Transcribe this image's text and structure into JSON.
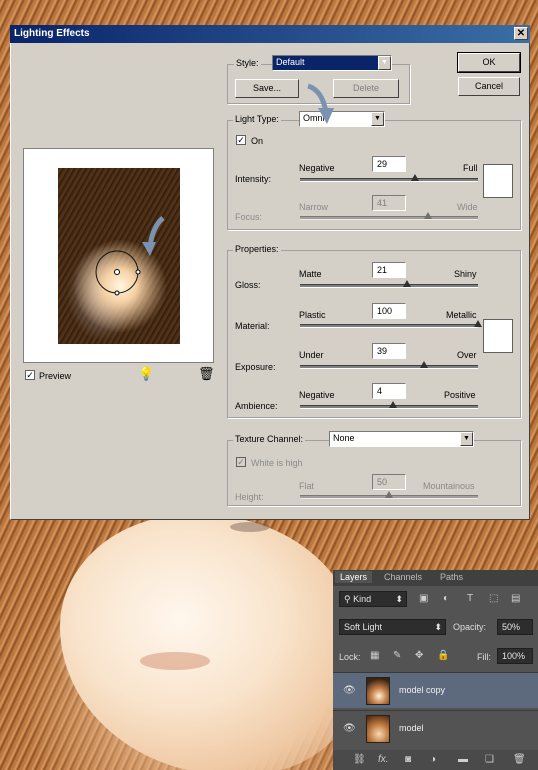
{
  "dialog": {
    "title": "Lighting Effects",
    "close": "✕",
    "ok": "OK",
    "cancel": "Cancel",
    "style_label": "Style:",
    "style_value": "Default",
    "save": "Save...",
    "delete": "Delete",
    "light_type_label": "Light Type:",
    "light_type_value": "Omni",
    "on_label": "On",
    "on_checked": "✓",
    "intensity": {
      "label": "Intensity:",
      "left": "Negative",
      "right": "Full",
      "value": "29"
    },
    "focus": {
      "label": "Focus:",
      "left": "Narrow",
      "right": "Wide",
      "value": "41"
    },
    "properties_label": "Properties:",
    "gloss": {
      "label": "Gloss:",
      "left": "Matte",
      "right": "Shiny",
      "value": "21"
    },
    "material": {
      "label": "Material:",
      "left": "Plastic",
      "right": "Metallic",
      "value": "100"
    },
    "exposure": {
      "label": "Exposure:",
      "left": "Under",
      "right": "Over",
      "value": "39"
    },
    "ambience": {
      "label": "Ambience:",
      "left": "Negative",
      "right": "Positive",
      "value": "4"
    },
    "texture_label": "Texture Channel:",
    "texture_value": "None",
    "white_high": "White is high",
    "white_checked": "✓",
    "height": {
      "label": "Height:",
      "left": "Flat",
      "right": "Mountainous",
      "value": "50"
    },
    "preview_label": "Preview",
    "preview_checked": "✓",
    "bulb_icon": "💡",
    "trash_icon": "🗑"
  },
  "layers_panel": {
    "tabs": [
      "Layers",
      "Channels",
      "Paths"
    ],
    "kind": "Kind",
    "blend_mode": "Soft Light",
    "opacity_label": "Opacity:",
    "opacity_value": "50%",
    "lock_label": "Lock:",
    "fill_label": "Fill:",
    "fill_value": "100%",
    "layers": [
      {
        "name": "model copy",
        "selected": true
      },
      {
        "name": "model",
        "selected": false
      }
    ],
    "bottom_tools": [
      "link-icon",
      "fx-icon",
      "mask-icon",
      "adjustment-icon",
      "folder-icon",
      "new-layer-icon",
      "trash-icon"
    ],
    "fx_text": "fx."
  }
}
